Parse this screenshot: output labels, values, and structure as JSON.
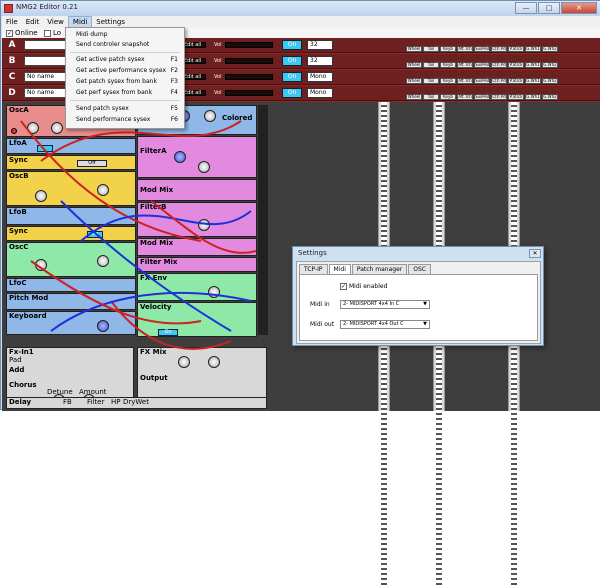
{
  "window": {
    "title": "NMG2 Editor 0.21",
    "minimize": "—",
    "maximize": "□",
    "close": "✕"
  },
  "menubar": {
    "items": [
      "File",
      "Edit",
      "View",
      "Midi",
      "Settings"
    ]
  },
  "toolbar": {
    "online_label": "Online",
    "online_checked": "✓",
    "second_label": "Lo"
  },
  "slots": [
    {
      "letter": "A",
      "name": "",
      "on": "On",
      "value": "32",
      "tags": [
        "Wheel",
        "Tail",
        "Keyb",
        "Aft.Tch",
        "SusPed",
        "Ctrl.Pd",
        "P.Stick",
        "G.Wh1",
        "G.Wh2"
      ]
    },
    {
      "letter": "B",
      "name": "",
      "on": "On",
      "value": "32",
      "tags": [
        "Wheel",
        "Tail",
        "Keyb",
        "Aft.Tch",
        "SusPed",
        "Ctrl.Pd",
        "P.Stick",
        "G.Wh1",
        "G.Wh2"
      ]
    },
    {
      "letter": "C",
      "name": "No name",
      "on": "On",
      "value": "Mono",
      "tags": [
        "Wheel",
        "Tail",
        "Keyb",
        "Aft.Tch",
        "SusPed",
        "Ctrl.Pd",
        "P.Stick",
        "G.Wh1",
        "G.Wh2"
      ]
    },
    {
      "letter": "D",
      "name": "No name",
      "on": "On",
      "value": "Mono",
      "tags": [
        "Wheel",
        "Tail",
        "Keyb",
        "Aft.Tch",
        "SusPed",
        "Ctrl.Pd",
        "P.Stick",
        "G.Wh1",
        "G.Wh2"
      ]
    }
  ],
  "slot_labels": {
    "edit": "Edit all",
    "vol": "Vol"
  },
  "midi_menu": {
    "items": [
      {
        "label": "Midi dump",
        "shortcut": ""
      },
      {
        "label": "Send controler snapshot",
        "shortcut": ""
      },
      {
        "label": "Get active patch sysex",
        "shortcut": "F1"
      },
      {
        "label": "Get active performance sysex",
        "shortcut": "F2"
      },
      {
        "label": "Get patch sysex from bank",
        "shortcut": "F3"
      },
      {
        "label": "Get perf sysex from bank",
        "shortcut": "F4"
      },
      {
        "label": "Send patch sysex",
        "shortcut": "F5"
      },
      {
        "label": "Send performance sysex",
        "shortcut": "F6"
      }
    ]
  },
  "modules": {
    "osca": "OscA",
    "lfoa": "LfoA",
    "sync": "Sync",
    "oscb": "OscB",
    "lfob": "LfoB",
    "oscc": "OscC",
    "lfoc": "LfoC",
    "pitch_mod": "Pitch Mod",
    "keyboard": "Keyboard",
    "filtera": "FilterA",
    "mod_mix": "Mod Mix",
    "filterb": "FilterB",
    "filter_mix": "Filter Mix",
    "fx_env": "FX Env",
    "velocity": "Velocity",
    "colored": "Colored",
    "off": "Off",
    "on": "On",
    "fxin": "Fx-In1",
    "add": "Add",
    "chorus": "Chorus",
    "delay": "Delay",
    "fx_mix": "FX Mix",
    "output": "Output",
    "detune": "Detune",
    "amount": "Amount",
    "pad": "Pad",
    "fb": "FB",
    "filter": "Filter",
    "hp": "HP",
    "dry_wet": "DryWet"
  },
  "settings": {
    "title": "Settings",
    "close": "✕",
    "tabs": [
      "TCP-IP",
      "Midi",
      "Patch manager",
      "OSC"
    ],
    "active_tab": "Midi",
    "midi_enabled_label": "Midi enabled",
    "midi_enabled_check": "✓",
    "midi_in_label": "Midi in",
    "midi_in_value": "2- MIDISPORT 4x4 In C",
    "midi_out_label": "Midi out",
    "midi_out_value": "2- MIDISPORT 4x4 Out C"
  },
  "colors": {
    "titlebar": "#cfe0f2",
    "slot_bg": "#6e1f1f",
    "module_red": "#e88c8c",
    "module_yellow": "#f2d24a",
    "module_blue": "#8fb8e8",
    "module_magenta": "#e28ae0",
    "module_green": "#8ee8a8",
    "button": "#3cc8f0",
    "patch_bg": "#3e3e3e"
  }
}
